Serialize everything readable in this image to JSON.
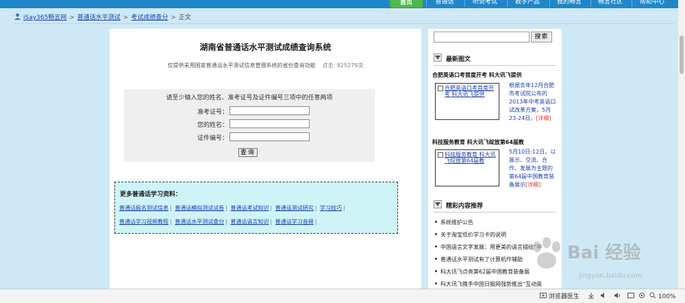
{
  "nav": {
    "items": [
      {
        "label": "首页",
        "active": true
      },
      {
        "label": "普通话",
        "active": false
      },
      {
        "label": "听说考试",
        "active": false
      },
      {
        "label": "教学产品",
        "active": false
      },
      {
        "label": "我的畅言",
        "active": false
      },
      {
        "label": "畅言社区",
        "active": false
      },
      {
        "label": "帮助中心",
        "active": false
      }
    ]
  },
  "breadcrumb": {
    "items": [
      "iSay365畅言网",
      "普通话水平测试",
      "考试成绩查分"
    ],
    "current": "正文",
    "separator": ">"
  },
  "main": {
    "title": "湖南省普通话水平测试成绩查询系统",
    "subtitle": "仅提供采用国家普通话水平测试信息管理系统的省份查询功能",
    "counter_label": "点击:",
    "counter_value": "825279次"
  },
  "query": {
    "hint": "请至少输入您的姓名、准考证号及证件编号三项中的任意两项",
    "fields": [
      {
        "label": "准考证号：",
        "value": ""
      },
      {
        "label": "您的姓名：",
        "value": ""
      },
      {
        "label": "证件编号：",
        "value": ""
      }
    ],
    "button_label": "查询"
  },
  "resources": {
    "title": "更多普通话学习资料：",
    "row1": [
      "普通话报名测试信息",
      "普通话模拟测试试卷",
      "普通话考试知识",
      "普通话测试研究",
      "学习技巧"
    ],
    "row2": [
      "普通话学习视频教程",
      "普通话水平测试查分",
      "普通话语言知识",
      "普通话学习音频"
    ]
  },
  "sidebar": {
    "search_placeholder": "",
    "search_button": "搜索",
    "latest_heading": "最新图文",
    "news": [
      {
        "title": "合肥英语口考首度开考 科大讯飞提供",
        "thumb_link": "合肥英语口考首度开考 科大讯飞提供",
        "summary": "根据去年12月合肥市考试院公布的2013年中考英语口试改革方案，5月23-24日，",
        "more": "[详细]"
      },
      {
        "title": "科技服务教育 科大讯飞绽放第64届教",
        "thumb_link": "科技服务教育 科大讯飞绽放第64届教",
        "summary": "5月10日-12日，以展示、交流、合作、发展为主题的第64届中国教育装备展示",
        "more": "[详细]"
      }
    ],
    "recommend_heading": "精彩内容推荐",
    "recommend": [
      "系统维护公告",
      "关于淘宝低价学习卡的说明",
      "中国语言文字发展：用更美的语言描绘“中",
      "普通话水平测试有了计算机作辅助",
      "科大讯飞点亮第62届中国教育装备展",
      "科大讯飞携手中国日报网强势推出“互动英"
    ]
  },
  "statusbar": {
    "browser_doctor": "浏览器医生",
    "zoom": "100%"
  },
  "watermark": {
    "text": "Bai 经验",
    "url": "jingyan.baidu.com"
  },
  "colors": {
    "nav_bg": "#1f87c9",
    "nav_active": "#4fb84b",
    "page_bg": "#cfe8f5",
    "link": "#1a3fb0",
    "resources_bg": "#cff4f8",
    "more_link": "#dd3333"
  }
}
